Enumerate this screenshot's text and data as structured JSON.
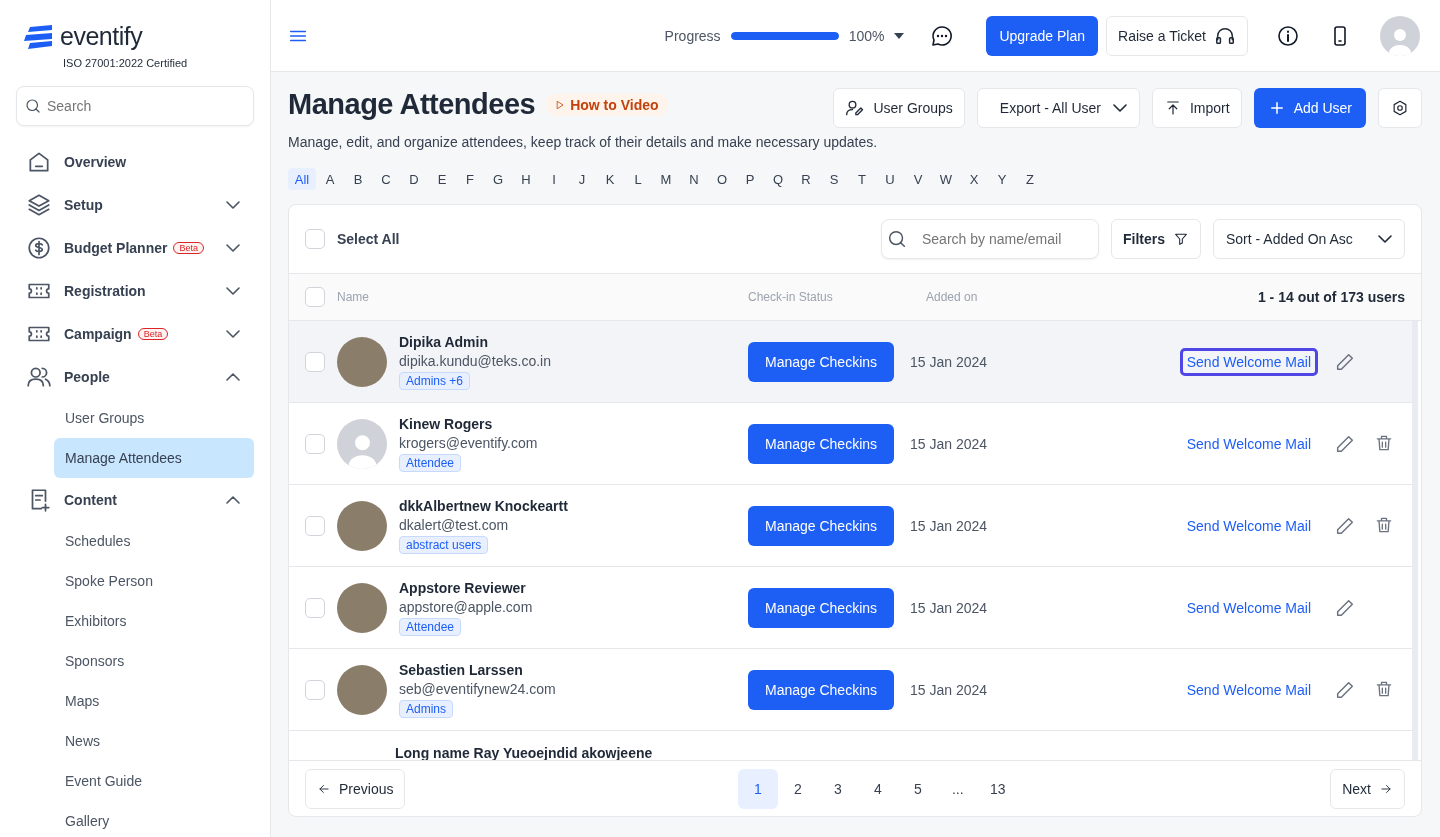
{
  "brand": {
    "name": "eventify",
    "certification": "ISO 27001:2022 Certified"
  },
  "sidebar": {
    "search": {
      "placeholder": "Search"
    },
    "items": [
      {
        "label": "Overview"
      },
      {
        "label": "Setup",
        "expanded": false
      },
      {
        "label": "Budget Planner",
        "badge": "Beta",
        "expanded": false
      },
      {
        "label": "Registration",
        "expanded": false
      },
      {
        "label": "Campaign",
        "badge": "Beta",
        "expanded": false
      },
      {
        "label": "People",
        "expanded": true,
        "children": [
          {
            "label": "User Groups",
            "selected": false
          },
          {
            "label": "Manage Attendees",
            "selected": true
          }
        ]
      },
      {
        "label": "Content",
        "expanded": true,
        "children": [
          {
            "label": "Schedules",
            "selected": false
          },
          {
            "label": "Spoke Person",
            "selected": false
          },
          {
            "label": "Exhibitors",
            "selected": false
          },
          {
            "label": "Sponsors",
            "selected": false
          },
          {
            "label": "Maps",
            "selected": false
          },
          {
            "label": "News",
            "selected": false
          },
          {
            "label": "Event Guide",
            "selected": false
          },
          {
            "label": "Gallery",
            "selected": false
          }
        ]
      }
    ]
  },
  "topbar": {
    "progress": {
      "label": "Progress",
      "level": 1,
      "reading": "100%"
    },
    "upgrade": "Upgrade Plan",
    "ticket": "Raise a Ticket"
  },
  "page": {
    "title": "Manage Attendees",
    "video_link": "How to Video",
    "subtitle": "Manage, edit, and organize attendees, keep track of their details and make necessary updates.",
    "actions": {
      "user_groups": "User Groups",
      "export": "Export - All User",
      "import": "Import",
      "add": "Add User"
    }
  },
  "letters": [
    {
      "label": "All",
      "selected": true
    },
    {
      "label": "A",
      "selected": false
    },
    {
      "label": "B",
      "selected": false
    },
    {
      "label": "C",
      "selected": false
    },
    {
      "label": "D",
      "selected": false
    },
    {
      "label": "E",
      "selected": false
    },
    {
      "label": "F",
      "selected": false
    },
    {
      "label": "G",
      "selected": false
    },
    {
      "label": "H",
      "selected": false
    },
    {
      "label": "I",
      "selected": false
    },
    {
      "label": "J",
      "selected": false
    },
    {
      "label": "K",
      "selected": false
    },
    {
      "label": "L",
      "selected": false
    },
    {
      "label": "M",
      "selected": false
    },
    {
      "label": "N",
      "selected": false
    },
    {
      "label": "O",
      "selected": false
    },
    {
      "label": "P",
      "selected": false
    },
    {
      "label": "Q",
      "selected": false
    },
    {
      "label": "R",
      "selected": false
    },
    {
      "label": "S",
      "selected": false
    },
    {
      "label": "T",
      "selected": false
    },
    {
      "label": "U",
      "selected": false
    },
    {
      "label": "V",
      "selected": false
    },
    {
      "label": "W",
      "selected": false
    },
    {
      "label": "X",
      "selected": false
    },
    {
      "label": "Y",
      "selected": false
    },
    {
      "label": "Z",
      "selected": false
    }
  ],
  "table": {
    "select_all": {
      "label": "Select All",
      "checked": false
    },
    "search": {
      "placeholder": "Search by name/email"
    },
    "filters": "Filters",
    "sort": "Sort - Added On Asc",
    "columns": [
      "Name",
      "Check-in Status",
      "Added on"
    ],
    "count": "1 - 14 out of 173 users",
    "header_checked": false,
    "rows": [
      {
        "name": "Dipika Admin",
        "email": "dipika.kundu@teks.co.in",
        "tag": "Admins +6",
        "photo": true,
        "checked": false,
        "highlighted": true,
        "checkin": "Manage Checkins",
        "added": "15 Jan 2024",
        "mail": "Send Welcome Mail",
        "mail_focused": true,
        "deletable": false
      },
      {
        "name": "Kinew Rogers",
        "email": "krogers@eventify.com",
        "tag": "Attendee",
        "photo": false,
        "checked": false,
        "highlighted": false,
        "checkin": "Manage Checkins",
        "added": "15 Jan 2024",
        "mail": "Send Welcome Mail",
        "mail_focused": false,
        "deletable": true
      },
      {
        "name": "dkkAlbertnew Knockeartt",
        "email": "dkalert@test.com",
        "tag": "abstract users",
        "photo": true,
        "checked": false,
        "highlighted": false,
        "checkin": "Manage Checkins",
        "added": "15 Jan 2024",
        "mail": "Send Welcome Mail",
        "mail_focused": false,
        "deletable": true
      },
      {
        "name": "Appstore Reviewer",
        "email": "appstore@apple.com",
        "tag": "Attendee",
        "photo": true,
        "checked": false,
        "highlighted": false,
        "checkin": "Manage Checkins",
        "added": "15 Jan 2024",
        "mail": "Send Welcome Mail",
        "mail_focused": false,
        "deletable": false
      },
      {
        "name": "Sebastien Larssen",
        "email": "seb@eventifynew24.com",
        "tag": "Admins",
        "photo": true,
        "checked": false,
        "highlighted": false,
        "checkin": "Manage Checkins",
        "added": "15 Jan 2024",
        "mail": "Send Welcome Mail",
        "mail_focused": false,
        "deletable": true
      },
      {
        "name": "Long name Ray Yueoejndid akowjeene"
      }
    ],
    "pagination": {
      "previous": "Previous",
      "next": "Next",
      "pages": [
        {
          "label": "1",
          "selected": true
        },
        {
          "label": "2",
          "selected": false
        },
        {
          "label": "3",
          "selected": false
        },
        {
          "label": "4",
          "selected": false
        },
        {
          "label": "5",
          "selected": false
        },
        {
          "label": "...",
          "selected": false
        },
        {
          "label": "13",
          "selected": false
        }
      ]
    }
  }
}
